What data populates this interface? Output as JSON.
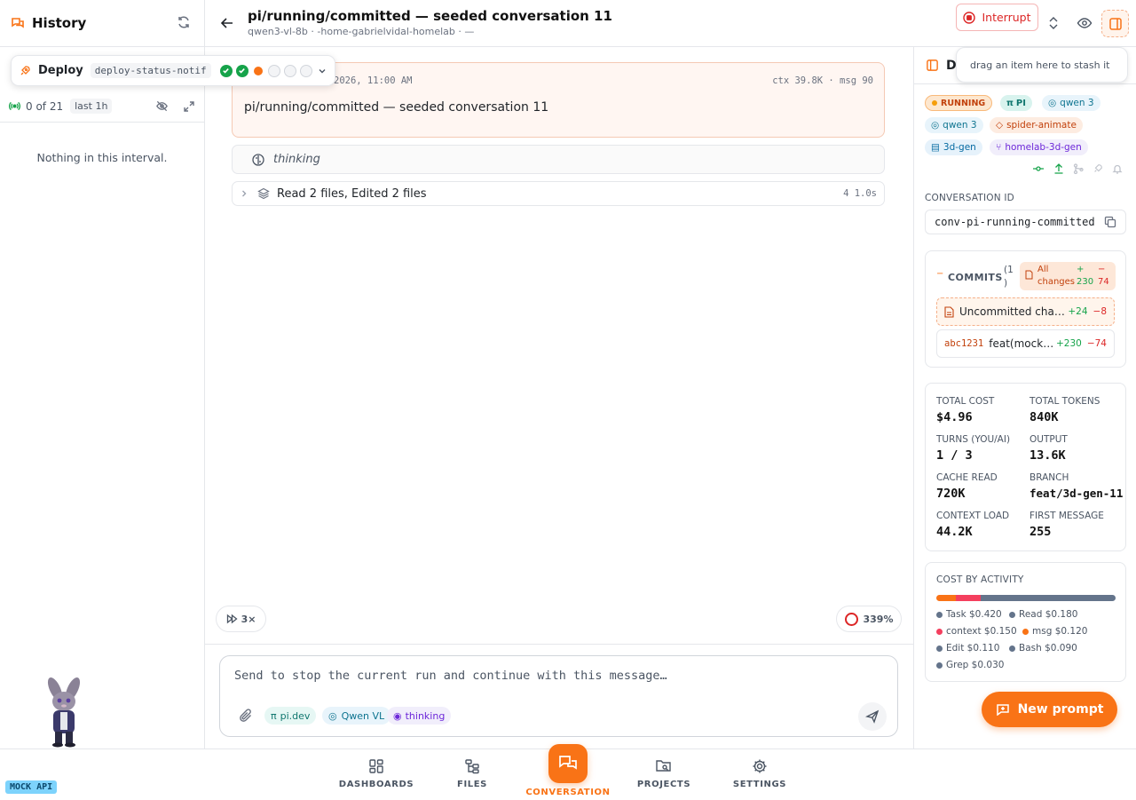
{
  "history": {
    "title": "History",
    "count": "0 of 21",
    "range": "last 1h",
    "empty": "Nothing in this interval."
  },
  "deploy": {
    "label": "Deploy",
    "tag": "deploy-status-notif",
    "steps": [
      "done",
      "done",
      "current",
      "pending",
      "pending",
      "pending"
    ]
  },
  "header": {
    "title": "pi/running/committed — seeded conversation 11",
    "subtitle": "qwen3-vl-8b · -home-gabrielvidal-homelab · —",
    "interrupt": "Interrupt"
  },
  "message": {
    "date": "2026, 11:00 AM",
    "ctx": "ctx 39.8K · msg 90",
    "body": "pi/running/committed — seeded conversation 11"
  },
  "thinking": {
    "label": "thinking"
  },
  "tools": {
    "summary": "Read 2 files, Edited 2 files",
    "time": "4 1.0s"
  },
  "speed": "3×",
  "context_pct": "339%",
  "composer": {
    "placeholder": "Send to stop the current run and continue with this message…",
    "chips": [
      "pi.dev",
      "Qwen VL",
      "thinking"
    ]
  },
  "right": {
    "title": "D",
    "stash_hint": "drag an item here to stash it",
    "badges": [
      "RUNNING",
      "PI",
      "qwen 3",
      "qwen 3",
      "spider-animate",
      "3d-gen",
      "homelab-3d-gen"
    ],
    "conv_id_label": "CONVERSATION ID",
    "conv_id": "conv-pi-running-committed",
    "commits": {
      "label": "COMMITS",
      "count": "(1",
      "count2": ")",
      "all_changes": "All",
      "all_changes2": "changes",
      "all_add": "+",
      "all_add2": "230",
      "all_del": "−",
      "all_del2": "74",
      "rows": [
        {
          "title": "Uncommitted cha…",
          "add": "+24",
          "del": "−8"
        },
        {
          "hash": "abc1231",
          "title": "feat(mock…",
          "add": "+230",
          "del": "−74"
        }
      ]
    },
    "stats": [
      {
        "k": "TOTAL COST",
        "v": "$4.96"
      },
      {
        "k": "TOTAL TOKENS",
        "v": "840K"
      },
      {
        "k": "TURNS (YOU/AI)",
        "v": "1 / 3"
      },
      {
        "k": "OUTPUT",
        "v": "13.6K"
      },
      {
        "k": "CACHE READ",
        "v": "720K"
      },
      {
        "k": "BRANCH",
        "v": "feat/3d-gen-11"
      },
      {
        "k": "CONTEXT LOAD",
        "v": "44.2K"
      },
      {
        "k": "FIRST MESSAGE",
        "v": "255"
      }
    ],
    "cost_by_activity": {
      "label": "COST BY ACTIVITY",
      "items": [
        {
          "name": "Task $0.420",
          "color": "#64748b"
        },
        {
          "name": "Read $0.180",
          "color": "#64748b"
        },
        {
          "name": "context $0.150",
          "color": "#f43f5e"
        },
        {
          "name": "msg $0.120",
          "color": "#f97316"
        },
        {
          "name": "Edit $0.110",
          "color": "#64748b"
        },
        {
          "name": "Bash $0.090",
          "color": "#64748b"
        },
        {
          "name": "Grep $0.030",
          "color": "#64748b"
        }
      ],
      "bar": [
        {
          "share": 0.11,
          "color": "#f97316"
        },
        {
          "share": 0.14,
          "color": "#f43f5e"
        },
        {
          "share": 0.75,
          "color": "#64748b"
        }
      ]
    },
    "new_prompt": "New prompt"
  },
  "nav": [
    "DASHBOARDS",
    "FILES",
    "CONVERSATION",
    "PROJECTS",
    "SETTINGS"
  ],
  "mock": "MOCK API"
}
